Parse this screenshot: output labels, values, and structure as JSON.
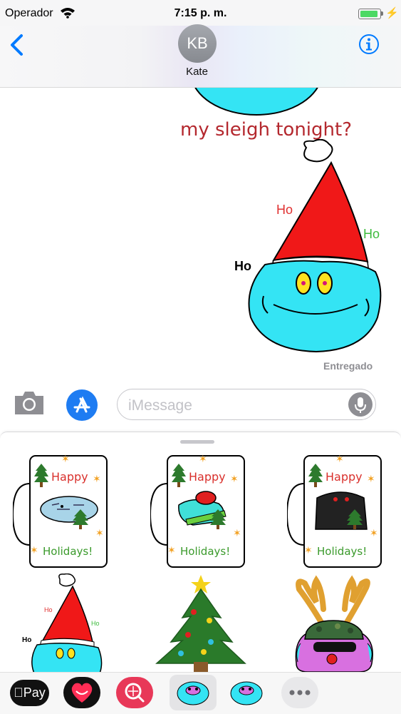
{
  "status_bar": {
    "carrier": "Operador",
    "time": "7:15 p. m."
  },
  "header": {
    "avatar_initials": "KB",
    "contact_name": "Kate"
  },
  "conversation": {
    "caption": "my sleigh tonight?",
    "sticker_words": {
      "left": "Ho",
      "top": "Ho",
      "right": "Ho"
    },
    "delivered": "Entregado"
  },
  "input_bar": {
    "placeholder": "iMessage"
  },
  "stickers": {
    "mug_top": "Happy",
    "mug_bottom": "Holidays!",
    "mini_words": {
      "left": "Ho",
      "top": "Ho",
      "right": "Ho"
    }
  },
  "app_strip": {
    "apple_pay": "Pay",
    "more": "•••"
  },
  "colors": {
    "accent": "#007aff",
    "text_red": "#b4282e",
    "cyan": "#34e4f4",
    "hat_red": "#f01818",
    "green_word": "#3dbb3d"
  }
}
